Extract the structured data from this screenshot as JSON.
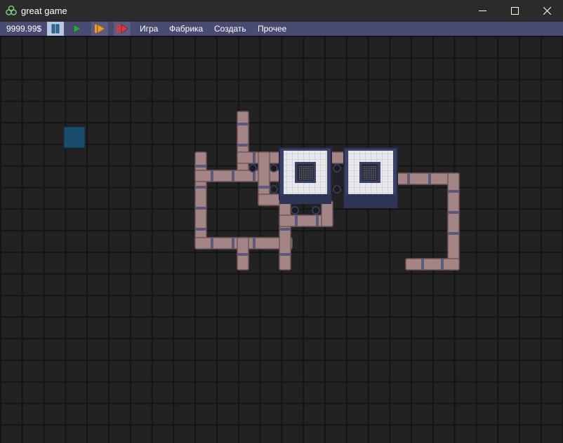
{
  "window": {
    "title": "great game",
    "app_icon": "biohazard-icon",
    "controls": [
      "minimize-icon",
      "maximize-icon",
      "close-icon"
    ]
  },
  "toolbar": {
    "money": "9999.99$",
    "speed_buttons": [
      {
        "name": "pause-icon",
        "color": "#2f6fa0",
        "active": true
      },
      {
        "name": "play-icon",
        "color": "#2ea24b"
      },
      {
        "name": "fast-forward-icon",
        "color": "#f39a26"
      },
      {
        "name": "fastest-forward-icon",
        "color": "#e0343f"
      }
    ],
    "menu": [
      "Игра",
      "Фабрика",
      "Создать",
      "Прочее"
    ]
  },
  "colors": {
    "titlebar": "#2b2b2b",
    "menubar": "#4a4b73",
    "grid_bg": "#222222",
    "grid_line": "#141414",
    "pipe": "#a48484",
    "pipe_joint": "#5c5a7c",
    "machine_frame": "#3b4166",
    "selection": "#1a4d6b"
  }
}
